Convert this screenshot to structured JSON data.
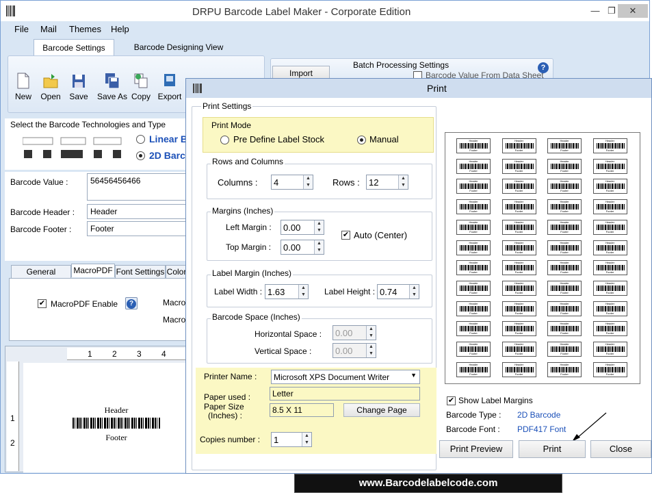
{
  "main_window": {
    "title": "DRPU Barcode Label Maker - Corporate Edition",
    "menu": [
      "File",
      "Mail",
      "Themes",
      "Help"
    ],
    "tabs": [
      "Barcode Settings",
      "Barcode Designing View"
    ],
    "toolbar": {
      "new": "New",
      "open": "Open",
      "save": "Save",
      "save_as": "Save As",
      "copy": "Copy",
      "export": "Export"
    },
    "import_label": "Import",
    "batch": {
      "title": "Batch Processing Settings",
      "checkbox_label": "Barcode Value From Data Sheet"
    },
    "technology": {
      "title": "Select the Barcode Technologies and Type",
      "linear": "Linear B",
      "two_d": "2D Barc"
    },
    "fields": {
      "value_label": "Barcode Value :",
      "value": "56456456466",
      "header_label": "Barcode Header :",
      "header": "Header",
      "footer_label": "Barcode Footer :",
      "footer": "Footer"
    },
    "subtabs": [
      "General Settings",
      "MacroPDF",
      "Font Settings",
      "Color"
    ],
    "macropdf_enable": "MacroPDF Enable",
    "macro_label_1": "Macro",
    "macro_label_2": "Macro",
    "ruler": [
      "1",
      "2",
      "3",
      "4"
    ],
    "vruler": [
      "1",
      "2"
    ],
    "preview": {
      "header": "Header",
      "footer": "Footer"
    }
  },
  "print_dialog": {
    "title": "Print",
    "settings_group": "Print Settings",
    "print_mode": {
      "title": "Print Mode",
      "option1": "Pre Define Label Stock",
      "option2": "Manual",
      "selected": "Manual"
    },
    "rows_cols": {
      "title": "Rows and Columns",
      "columns_label": "Columns :",
      "columns": "4",
      "rows_label": "Rows :",
      "rows": "12"
    },
    "margins": {
      "title": "Margins (Inches)",
      "left_label": "Left Margin :",
      "left": "0.00",
      "top_label": "Top Margin :",
      "top": "0.00",
      "auto_label": "Auto (Center)",
      "auto_checked": true
    },
    "label_margin": {
      "title": "Label Margin (Inches)",
      "width_label": "Label Width :",
      "width": "1.63",
      "height_label": "Label Height :",
      "height": "0.74"
    },
    "barcode_space": {
      "title": "Barcode Space (Inches)",
      "h_label": "Horizontal Space :",
      "h": "0.00",
      "v_label": "Vertical Space :",
      "v": "0.00"
    },
    "printer": {
      "name_label": "Printer Name :",
      "name": "Microsoft XPS Document Writer",
      "paper_used_label": "Paper used :",
      "paper_used": "Letter",
      "paper_size_label_1": "Paper Size",
      "paper_size_label_2": "(Inches) :",
      "paper_size": "8.5 X 11",
      "change_page": "Change Page",
      "copies_label": "Copies number :",
      "copies": "1"
    },
    "show_margins": "Show Label Margins",
    "barcode_type_label": "Barcode Type :",
    "barcode_type": "2D Barcode",
    "barcode_font_label": "Barcode Font :",
    "barcode_font": "PDF417 Font",
    "buttons": {
      "preview": "Print Preview",
      "print": "Print",
      "close": "Close"
    },
    "thumb": {
      "header": "Header",
      "footer": "Footer",
      "rows": 12,
      "cols": 4
    },
    "highlight_color": "#fbf8c4"
  },
  "website_banner": "www.Barcodelabelcode.com"
}
